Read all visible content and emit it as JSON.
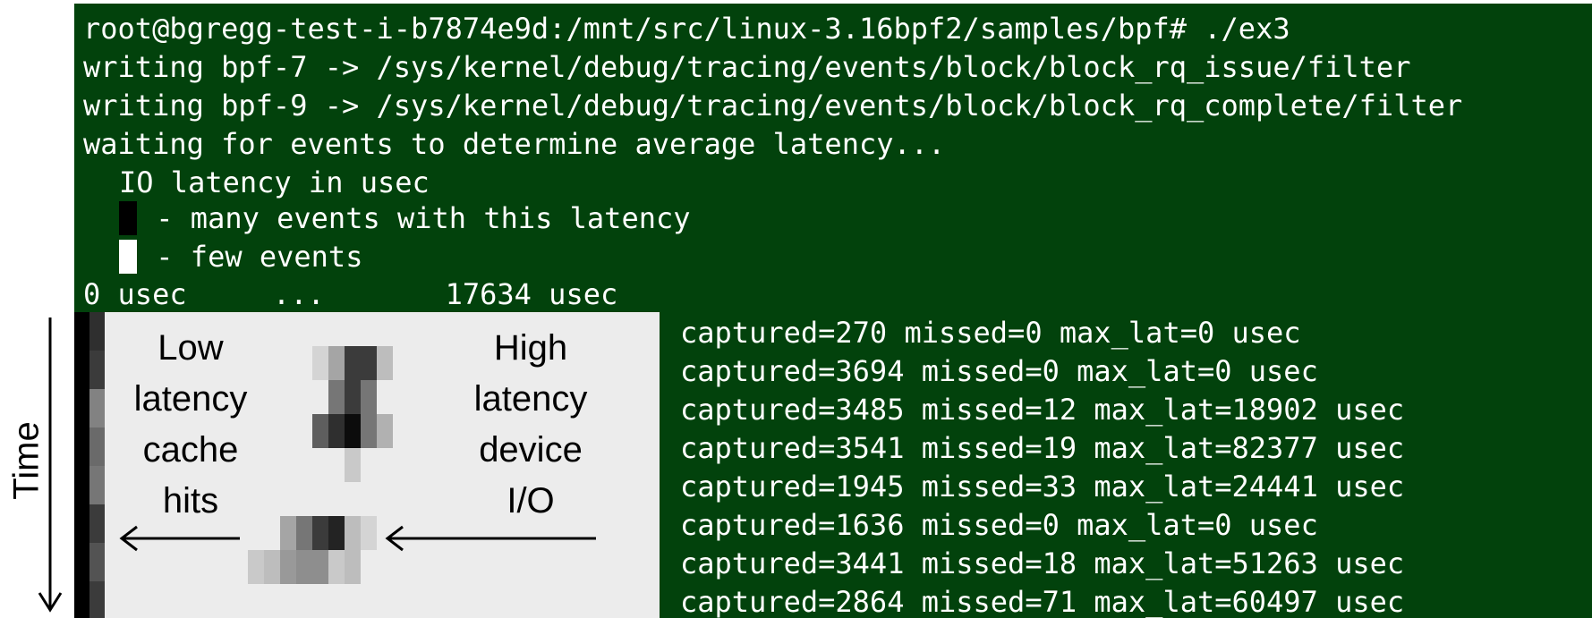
{
  "terminal": {
    "prompt_line": "root@bgregg-test-i-b7874e9d:/mnt/src/linux-3.16bpf2/samples/bpf# ./ex3",
    "write_line_1": "writing bpf-7 -> /sys/kernel/debug/tracing/events/block/block_rq_issue/filter",
    "write_line_2": "writing bpf-9 -> /sys/kernel/debug/tracing/events/block/block_rq_complete/filter",
    "waiting_line": "waiting for events to determine average latency...",
    "legend_title": "IO latency in usec",
    "legend_many": " - many events with this latency",
    "legend_few": " - few events",
    "range_line": "0 usec     ...       17634 usec",
    "legend_colors": {
      "many": "#000000",
      "few": "#ffffff"
    },
    "background_color": "#02420c"
  },
  "stats": [
    "captured=270 missed=0 max_lat=0 usec",
    "captured=3694 missed=0 max_lat=0 usec",
    "captured=3485 missed=12 max_lat=18902 usec",
    "captured=3541 missed=19 max_lat=82377 usec",
    "captured=1945 missed=33 max_lat=24441 usec",
    "captured=1636 missed=0 max_lat=0 usec",
    "captured=3441 missed=18 max_lat=51263 usec",
    "captured=2864 missed=71 max_lat=60497 usec"
  ],
  "annotations": {
    "low": [
      "Low",
      "latency",
      "cache",
      "hits"
    ],
    "high": [
      "High",
      "latency",
      "device",
      "I/O"
    ],
    "time_axis": "Time"
  },
  "heatmap": {
    "background_color": "#ececec",
    "column_0": [
      1,
      1,
      1,
      1,
      1,
      1,
      1,
      1
    ],
    "column_1": [
      0.8,
      0.75,
      0.45,
      0.55,
      0.5,
      0.75,
      0.65,
      0.75
    ],
    "high_cluster_1": [
      [
        0,
        0,
        0.1,
        0.3,
        0.75,
        0.75,
        0.2,
        0
      ],
      [
        0,
        0,
        0,
        0.5,
        0.75,
        0.5,
        0,
        0
      ],
      [
        0,
        0,
        0.6,
        0.8,
        0.95,
        0.5,
        0.25,
        0
      ],
      [
        0,
        0,
        0,
        0,
        0.15,
        0,
        0,
        0
      ]
    ],
    "high_cluster_2": [
      [
        0,
        0,
        0.3,
        0.5,
        0.75,
        0.85,
        0.2,
        0.1
      ],
      [
        0.15,
        0.2,
        0.35,
        0.4,
        0.4,
        0.15,
        0.2,
        0
      ]
    ]
  }
}
